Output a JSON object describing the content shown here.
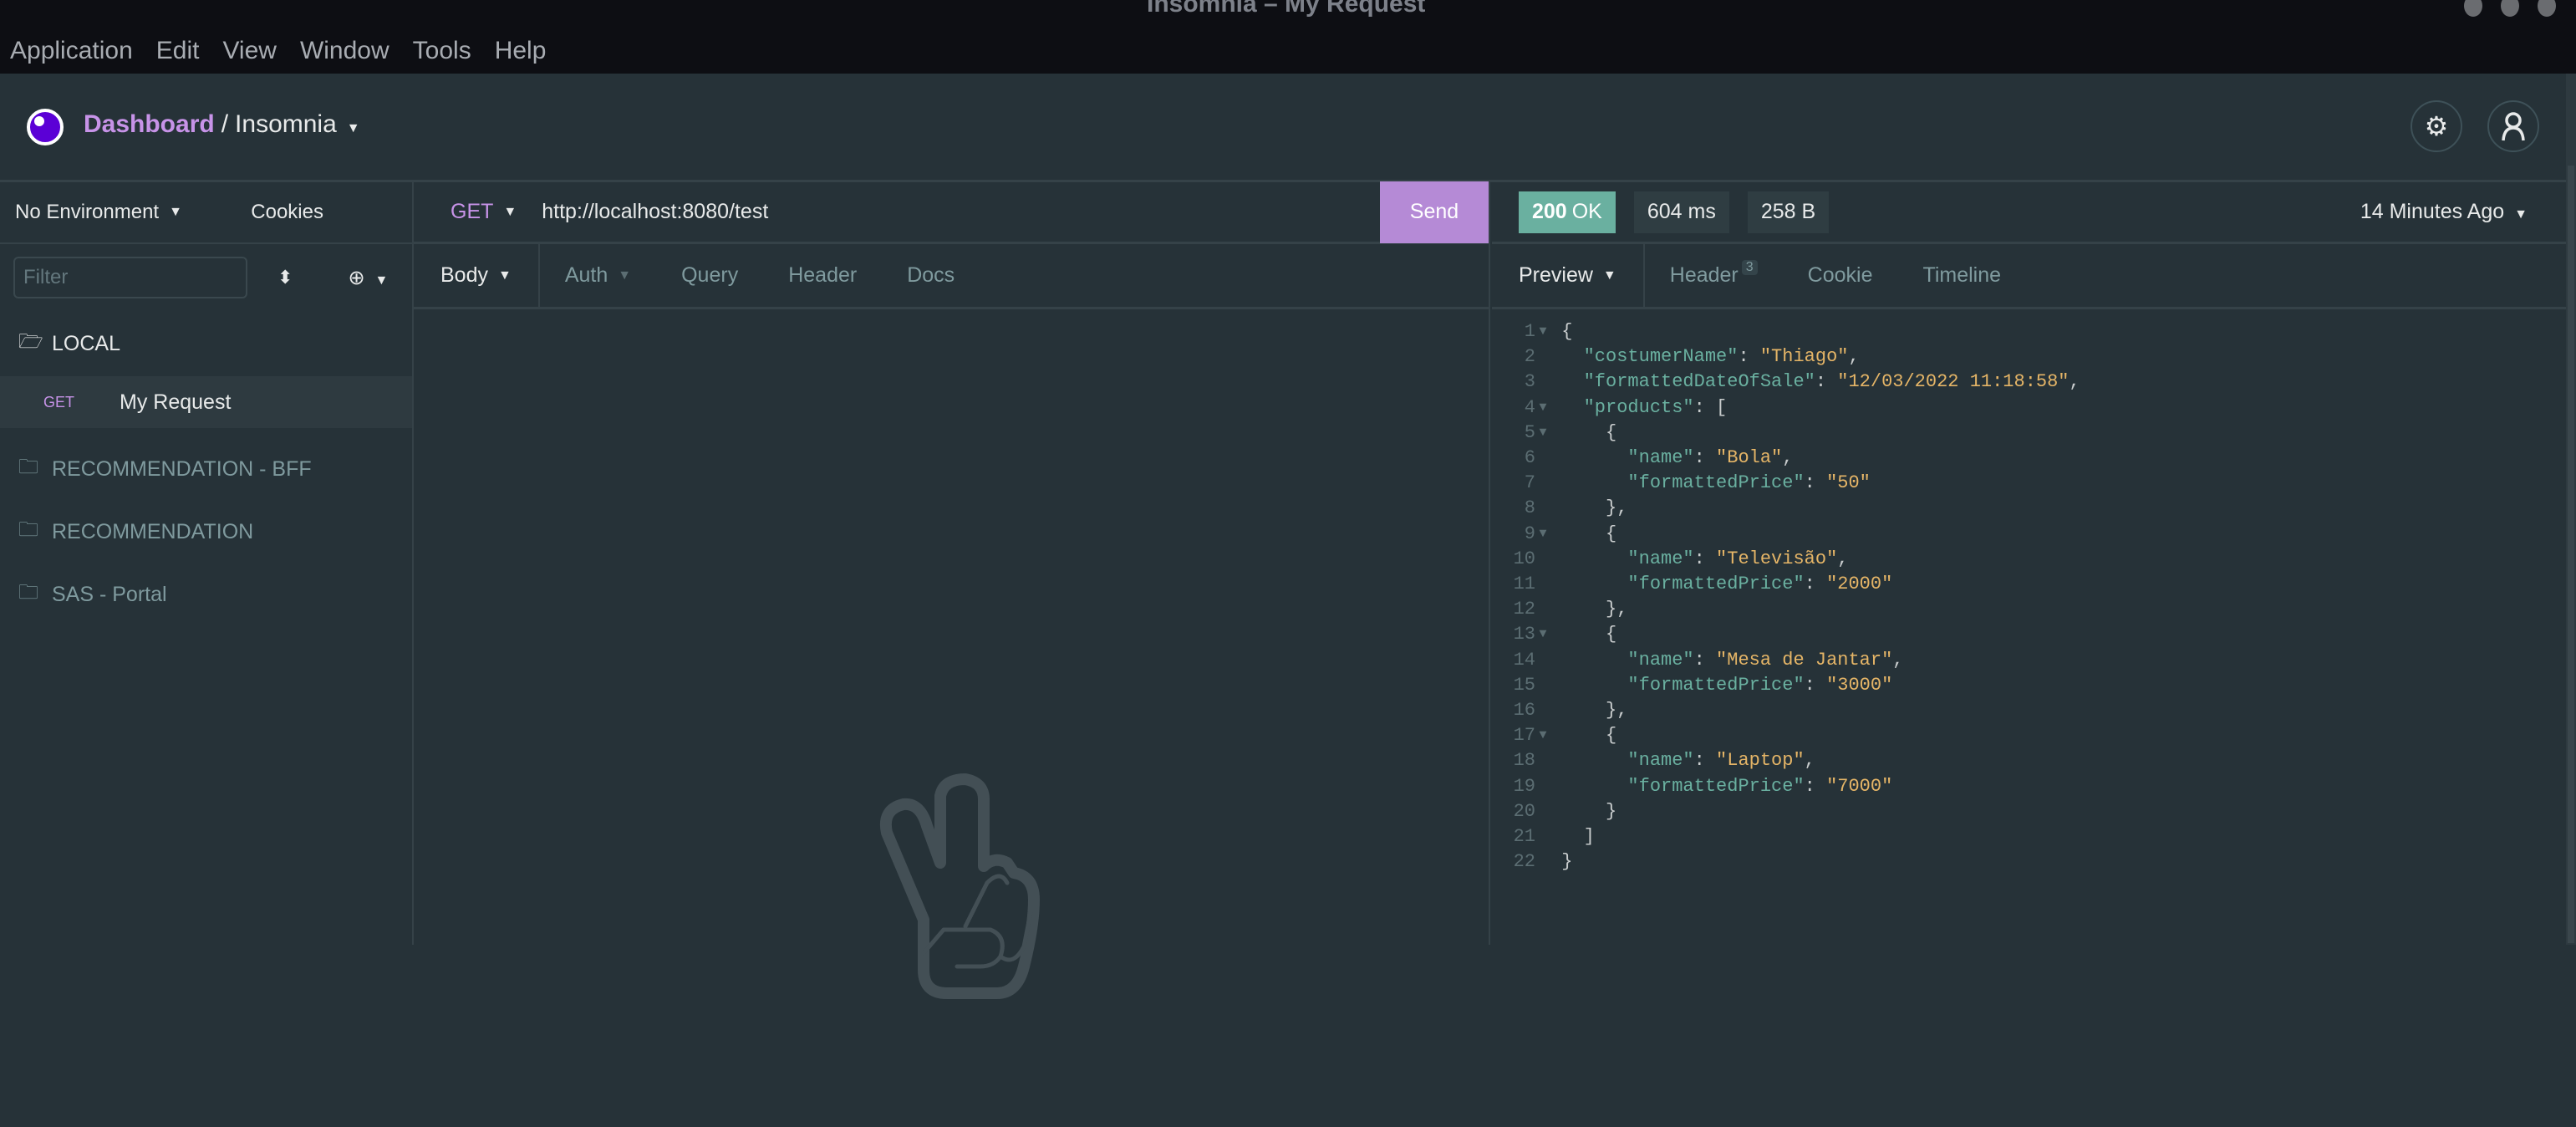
{
  "window": {
    "title": "Insomnia – My Request"
  },
  "menu": [
    "Application",
    "Edit",
    "View",
    "Window",
    "Tools",
    "Help"
  ],
  "header": {
    "dashboard": "Dashboard",
    "separator": "/",
    "workspace": "Insomnia"
  },
  "sidebar": {
    "environment": "No Environment",
    "cookies": "Cookies",
    "filter_placeholder": "Filter",
    "items": [
      {
        "label": "LOCAL",
        "type": "folder-open"
      },
      {
        "label": "My Request",
        "method": "GET"
      },
      {
        "label": "RECOMMENDATION - BFF",
        "type": "folder"
      },
      {
        "label": "RECOMMENDATION",
        "type": "folder"
      },
      {
        "label": "SAS - Portal",
        "type": "folder"
      }
    ]
  },
  "request": {
    "method": "GET",
    "url": "http://localhost:8080/test",
    "send": "Send",
    "tabs": [
      "Body",
      "Auth",
      "Query",
      "Header",
      "Docs"
    ]
  },
  "response": {
    "status_code": "200",
    "status_text": "OK",
    "time": "604 ms",
    "size": "258 B",
    "ago": "14 Minutes Ago",
    "tabs": [
      "Preview",
      "Header",
      "Cookie",
      "Timeline"
    ],
    "header_count": "3",
    "lines": [
      {
        "n": "1",
        "fold": true,
        "i": 0,
        "t": [
          [
            "p",
            "{"
          ]
        ]
      },
      {
        "n": "2",
        "i": 1,
        "t": [
          [
            "k",
            "\"costumerName\""
          ],
          [
            "p",
            ": "
          ],
          [
            "s",
            "\"Thiago\""
          ],
          [
            "p",
            ","
          ]
        ]
      },
      {
        "n": "3",
        "i": 1,
        "t": [
          [
            "k",
            "\"formattedDateOfSale\""
          ],
          [
            "p",
            ": "
          ],
          [
            "s",
            "\"12/03/2022 11:18:58\""
          ],
          [
            "p",
            ","
          ]
        ]
      },
      {
        "n": "4",
        "fold": true,
        "i": 1,
        "t": [
          [
            "k",
            "\"products\""
          ],
          [
            "p",
            ": ["
          ]
        ]
      },
      {
        "n": "5",
        "fold": true,
        "i": 2,
        "t": [
          [
            "p",
            "{"
          ]
        ]
      },
      {
        "n": "6",
        "i": 3,
        "t": [
          [
            "k",
            "\"name\""
          ],
          [
            "p",
            ": "
          ],
          [
            "s",
            "\"Bola\""
          ],
          [
            "p",
            ","
          ]
        ]
      },
      {
        "n": "7",
        "i": 3,
        "t": [
          [
            "k",
            "\"formattedPrice\""
          ],
          [
            "p",
            ": "
          ],
          [
            "s",
            "\"50\""
          ]
        ]
      },
      {
        "n": "8",
        "i": 2,
        "t": [
          [
            "p",
            "},"
          ]
        ]
      },
      {
        "n": "9",
        "fold": true,
        "i": 2,
        "t": [
          [
            "p",
            "{"
          ]
        ]
      },
      {
        "n": "10",
        "i": 3,
        "t": [
          [
            "k",
            "\"name\""
          ],
          [
            "p",
            ": "
          ],
          [
            "s",
            "\"Televisão\""
          ],
          [
            "p",
            ","
          ]
        ]
      },
      {
        "n": "11",
        "i": 3,
        "t": [
          [
            "k",
            "\"formattedPrice\""
          ],
          [
            "p",
            ": "
          ],
          [
            "s",
            "\"2000\""
          ]
        ]
      },
      {
        "n": "12",
        "i": 2,
        "t": [
          [
            "p",
            "},"
          ]
        ]
      },
      {
        "n": "13",
        "fold": true,
        "i": 2,
        "t": [
          [
            "p",
            "{"
          ]
        ]
      },
      {
        "n": "14",
        "i": 3,
        "t": [
          [
            "k",
            "\"name\""
          ],
          [
            "p",
            ": "
          ],
          [
            "s",
            "\"Mesa de Jantar\""
          ],
          [
            "p",
            ","
          ]
        ]
      },
      {
        "n": "15",
        "i": 3,
        "t": [
          [
            "k",
            "\"formattedPrice\""
          ],
          [
            "p",
            ": "
          ],
          [
            "s",
            "\"3000\""
          ]
        ]
      },
      {
        "n": "16",
        "i": 2,
        "t": [
          [
            "p",
            "},"
          ]
        ]
      },
      {
        "n": "17",
        "fold": true,
        "i": 2,
        "t": [
          [
            "p",
            "{"
          ]
        ]
      },
      {
        "n": "18",
        "i": 3,
        "t": [
          [
            "k",
            "\"name\""
          ],
          [
            "p",
            ": "
          ],
          [
            "s",
            "\"Laptop\""
          ],
          [
            "p",
            ","
          ]
        ]
      },
      {
        "n": "19",
        "i": 3,
        "t": [
          [
            "k",
            "\"formattedPrice\""
          ],
          [
            "p",
            ": "
          ],
          [
            "s",
            "\"7000\""
          ]
        ]
      },
      {
        "n": "20",
        "i": 2,
        "t": [
          [
            "p",
            "}"
          ]
        ]
      },
      {
        "n": "21",
        "i": 1,
        "t": [
          [
            "p",
            "]"
          ]
        ]
      },
      {
        "n": "22",
        "i": 0,
        "t": [
          [
            "p",
            "}"
          ]
        ]
      }
    ]
  },
  "colors": {
    "accent": "#c793e8",
    "send": "#b58ad6",
    "ok": "#6ab0a0",
    "background": "#263238"
  }
}
